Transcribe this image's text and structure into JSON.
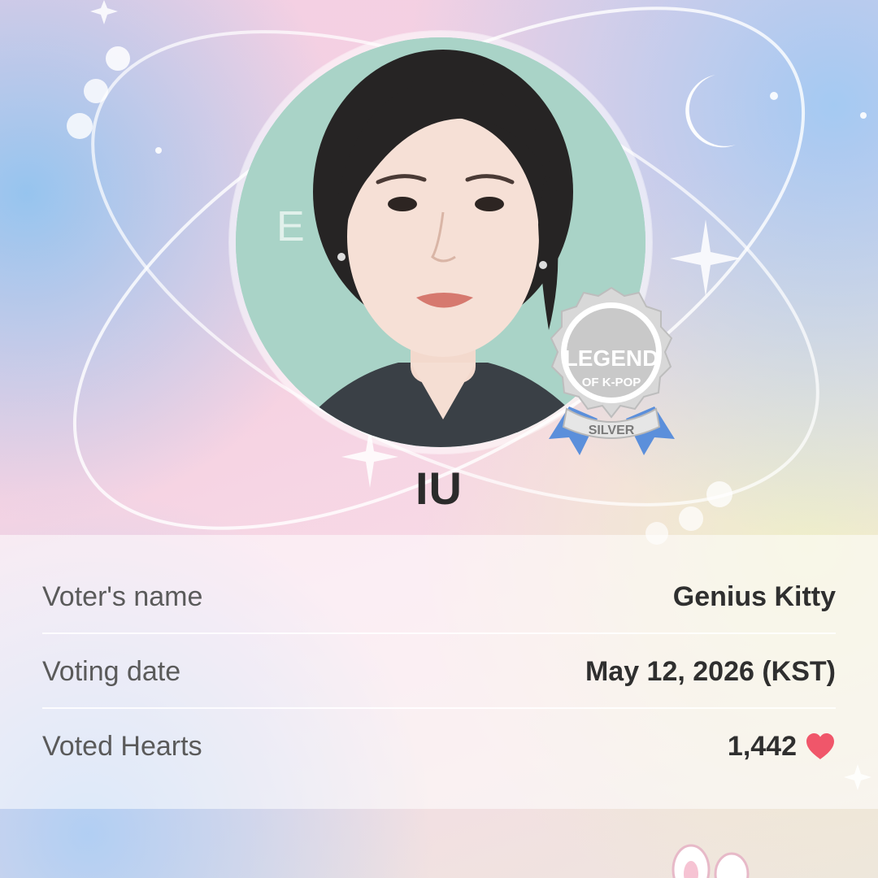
{
  "artist": {
    "name": "IU"
  },
  "badge": {
    "title": "LEGEND",
    "subtitle": "OF K-POP",
    "tier": "SILVER"
  },
  "vote_details": {
    "rows": [
      {
        "label": "Voter's name",
        "value": "Genius Kitty"
      },
      {
        "label": "Voting date",
        "value": "May 12, 2026 (KST)"
      },
      {
        "label": "Voted Hearts",
        "value": "1,442",
        "icon": "heart-icon"
      }
    ]
  },
  "colors": {
    "heart": "#f0566a",
    "ribbon": "#5b8fdb",
    "badge_silver": "#c8c8c8"
  }
}
